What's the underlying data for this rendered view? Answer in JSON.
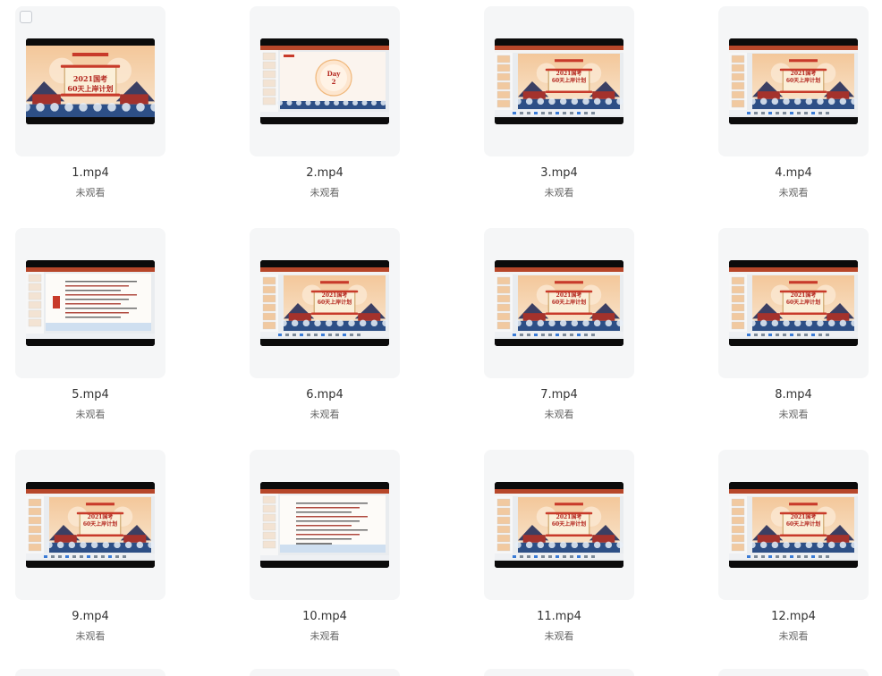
{
  "files": [
    {
      "name": "1.mp4",
      "status": "未观看",
      "thumb": "title",
      "slide_title_1": "2021国考",
      "slide_title_2": "60天上岸计划",
      "checkbox": true
    },
    {
      "name": "2.mp4",
      "status": "未观看",
      "thumb": "day",
      "day_label": "Day",
      "day_num": "2"
    },
    {
      "name": "3.mp4",
      "status": "未观看",
      "thumb": "ppt",
      "slide_title_1": "2021国考",
      "slide_title_2": "60天上岸计划"
    },
    {
      "name": "4.mp4",
      "status": "未观看",
      "thumb": "ppt",
      "slide_title_1": "2021国考",
      "slide_title_2": "60天上岸计划"
    },
    {
      "name": "5.mp4",
      "status": "未观看",
      "thumb": "text"
    },
    {
      "name": "6.mp4",
      "status": "未观看",
      "thumb": "ppt",
      "slide_title_1": "2021国考",
      "slide_title_2": "60天上岸计划"
    },
    {
      "name": "7.mp4",
      "status": "未观看",
      "thumb": "ppt",
      "slide_title_1": "2021国考",
      "slide_title_2": "60天上岸计划"
    },
    {
      "name": "8.mp4",
      "status": "未观看",
      "thumb": "ppt",
      "slide_title_1": "2021国考",
      "slide_title_2": "60天上岸计划"
    },
    {
      "name": "9.mp4",
      "status": "未观看",
      "thumb": "ppt",
      "slide_title_1": "2021国考",
      "slide_title_2": "60天上岸计划"
    },
    {
      "name": "10.mp4",
      "status": "未观看",
      "thumb": "text2"
    },
    {
      "name": "11.mp4",
      "status": "未观看",
      "thumb": "ppt",
      "slide_title_1": "2021国考",
      "slide_title_2": "60天上岸计划"
    },
    {
      "name": "12.mp4",
      "status": "未观看",
      "thumb": "ppt",
      "slide_title_1": "2021国考",
      "slide_title_2": "60天上岸计划"
    }
  ],
  "colors": {
    "card_bg": "#f5f6f7",
    "slide_warm": "#f6d9b4",
    "slide_accent": "#c83a2a",
    "wave_blue": "#2d4f86"
  }
}
